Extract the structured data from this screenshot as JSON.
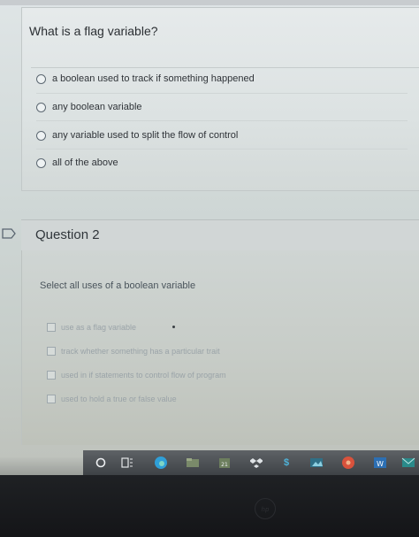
{
  "question1": {
    "title": "What is a flag variable?",
    "options": [
      {
        "label": "a boolean used to track if something happened"
      },
      {
        "label": "any boolean variable"
      },
      {
        "label": "any variable used to split the flow of control"
      },
      {
        "label": "all of the above"
      }
    ]
  },
  "question2": {
    "header": "Question 2",
    "prompt": "Select all uses of a boolean variable",
    "options": [
      {
        "label": "use as a flag variable"
      },
      {
        "label": "track whether something has a particular trait"
      },
      {
        "label": "used in if statements to control flow of program"
      },
      {
        "label": "used to hold a true or false value"
      }
    ]
  },
  "taskbar": {
    "icons": [
      "start-circle-icon",
      "task-view-icon",
      "edge-icon",
      "file-explorer-icon",
      "calendar-icon",
      "dropbox-icon",
      "money-icon",
      "photos-icon",
      "media-icon",
      "word-icon",
      "mail-icon"
    ]
  },
  "colors": {
    "taskbar": "#4a4e52",
    "bezel": "#1a1c1f",
    "text_dark": "#2b2f33"
  }
}
